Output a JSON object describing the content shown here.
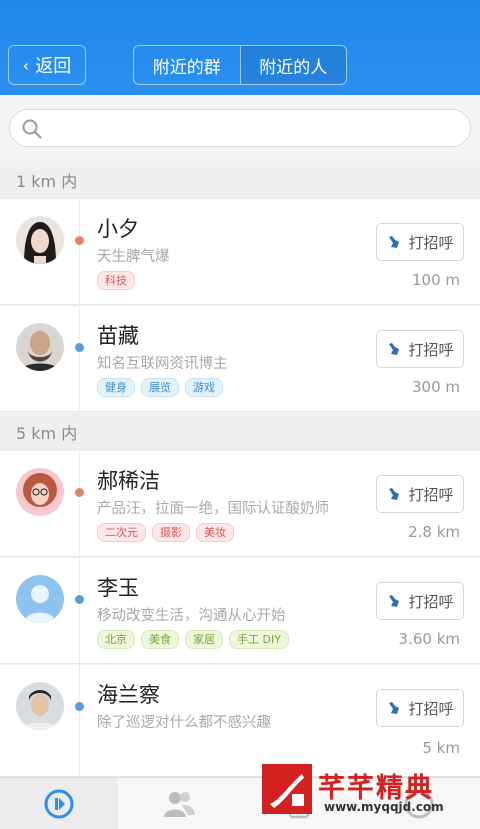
{
  "header": {
    "back_label": "返回",
    "tabs": [
      {
        "label": "附近的群",
        "active": false
      },
      {
        "label": "附近的人",
        "active": true
      }
    ]
  },
  "search": {
    "placeholder": ""
  },
  "sections": [
    {
      "title": "1 km 内"
    },
    {
      "title": "5 km 内"
    }
  ],
  "people": [
    {
      "name": "小夕",
      "signature": "天生脾气爆",
      "tags": [
        {
          "text": "科技",
          "color": "red"
        }
      ],
      "distance": "100 m",
      "greet": "打招呼",
      "gender": "female"
    },
    {
      "name": "苗藏",
      "signature": "知名互联网资讯博主",
      "tags": [
        {
          "text": "健身",
          "color": "blue"
        },
        {
          "text": "展览",
          "color": "blue"
        },
        {
          "text": "游戏",
          "color": "blue"
        }
      ],
      "distance": "300 m",
      "greet": "打招呼",
      "gender": "male"
    },
    {
      "name": "郝稀洁",
      "signature": "产品汪，拉面一绝，国际认证酸奶师",
      "tags": [
        {
          "text": "二次元",
          "color": "red"
        },
        {
          "text": "摄影",
          "color": "red"
        },
        {
          "text": "美妆",
          "color": "red"
        }
      ],
      "distance": "2.8 km",
      "greet": "打招呼",
      "gender": "female"
    },
    {
      "name": "李玉",
      "signature": "移动改变生活，沟通从心开始",
      "tags": [
        {
          "text": "北京",
          "color": "green"
        },
        {
          "text": "美食",
          "color": "green"
        },
        {
          "text": "家居",
          "color": "green"
        },
        {
          "text": "手工 DIY",
          "color": "green"
        }
      ],
      "distance": "3.60 km",
      "greet": "打招呼",
      "gender": "male"
    },
    {
      "name": "海兰察",
      "signature": "除了巡逻对什么都不感兴趣",
      "tags": [],
      "distance": "5 km",
      "greet": "打招呼",
      "gender": "male"
    }
  ],
  "watermark": {
    "title": "芊芊精典",
    "url": "www.myqqjd.com"
  },
  "colors": {
    "header": "#2b8ff0",
    "female": "#e2836a",
    "male": "#5b9bd8"
  }
}
